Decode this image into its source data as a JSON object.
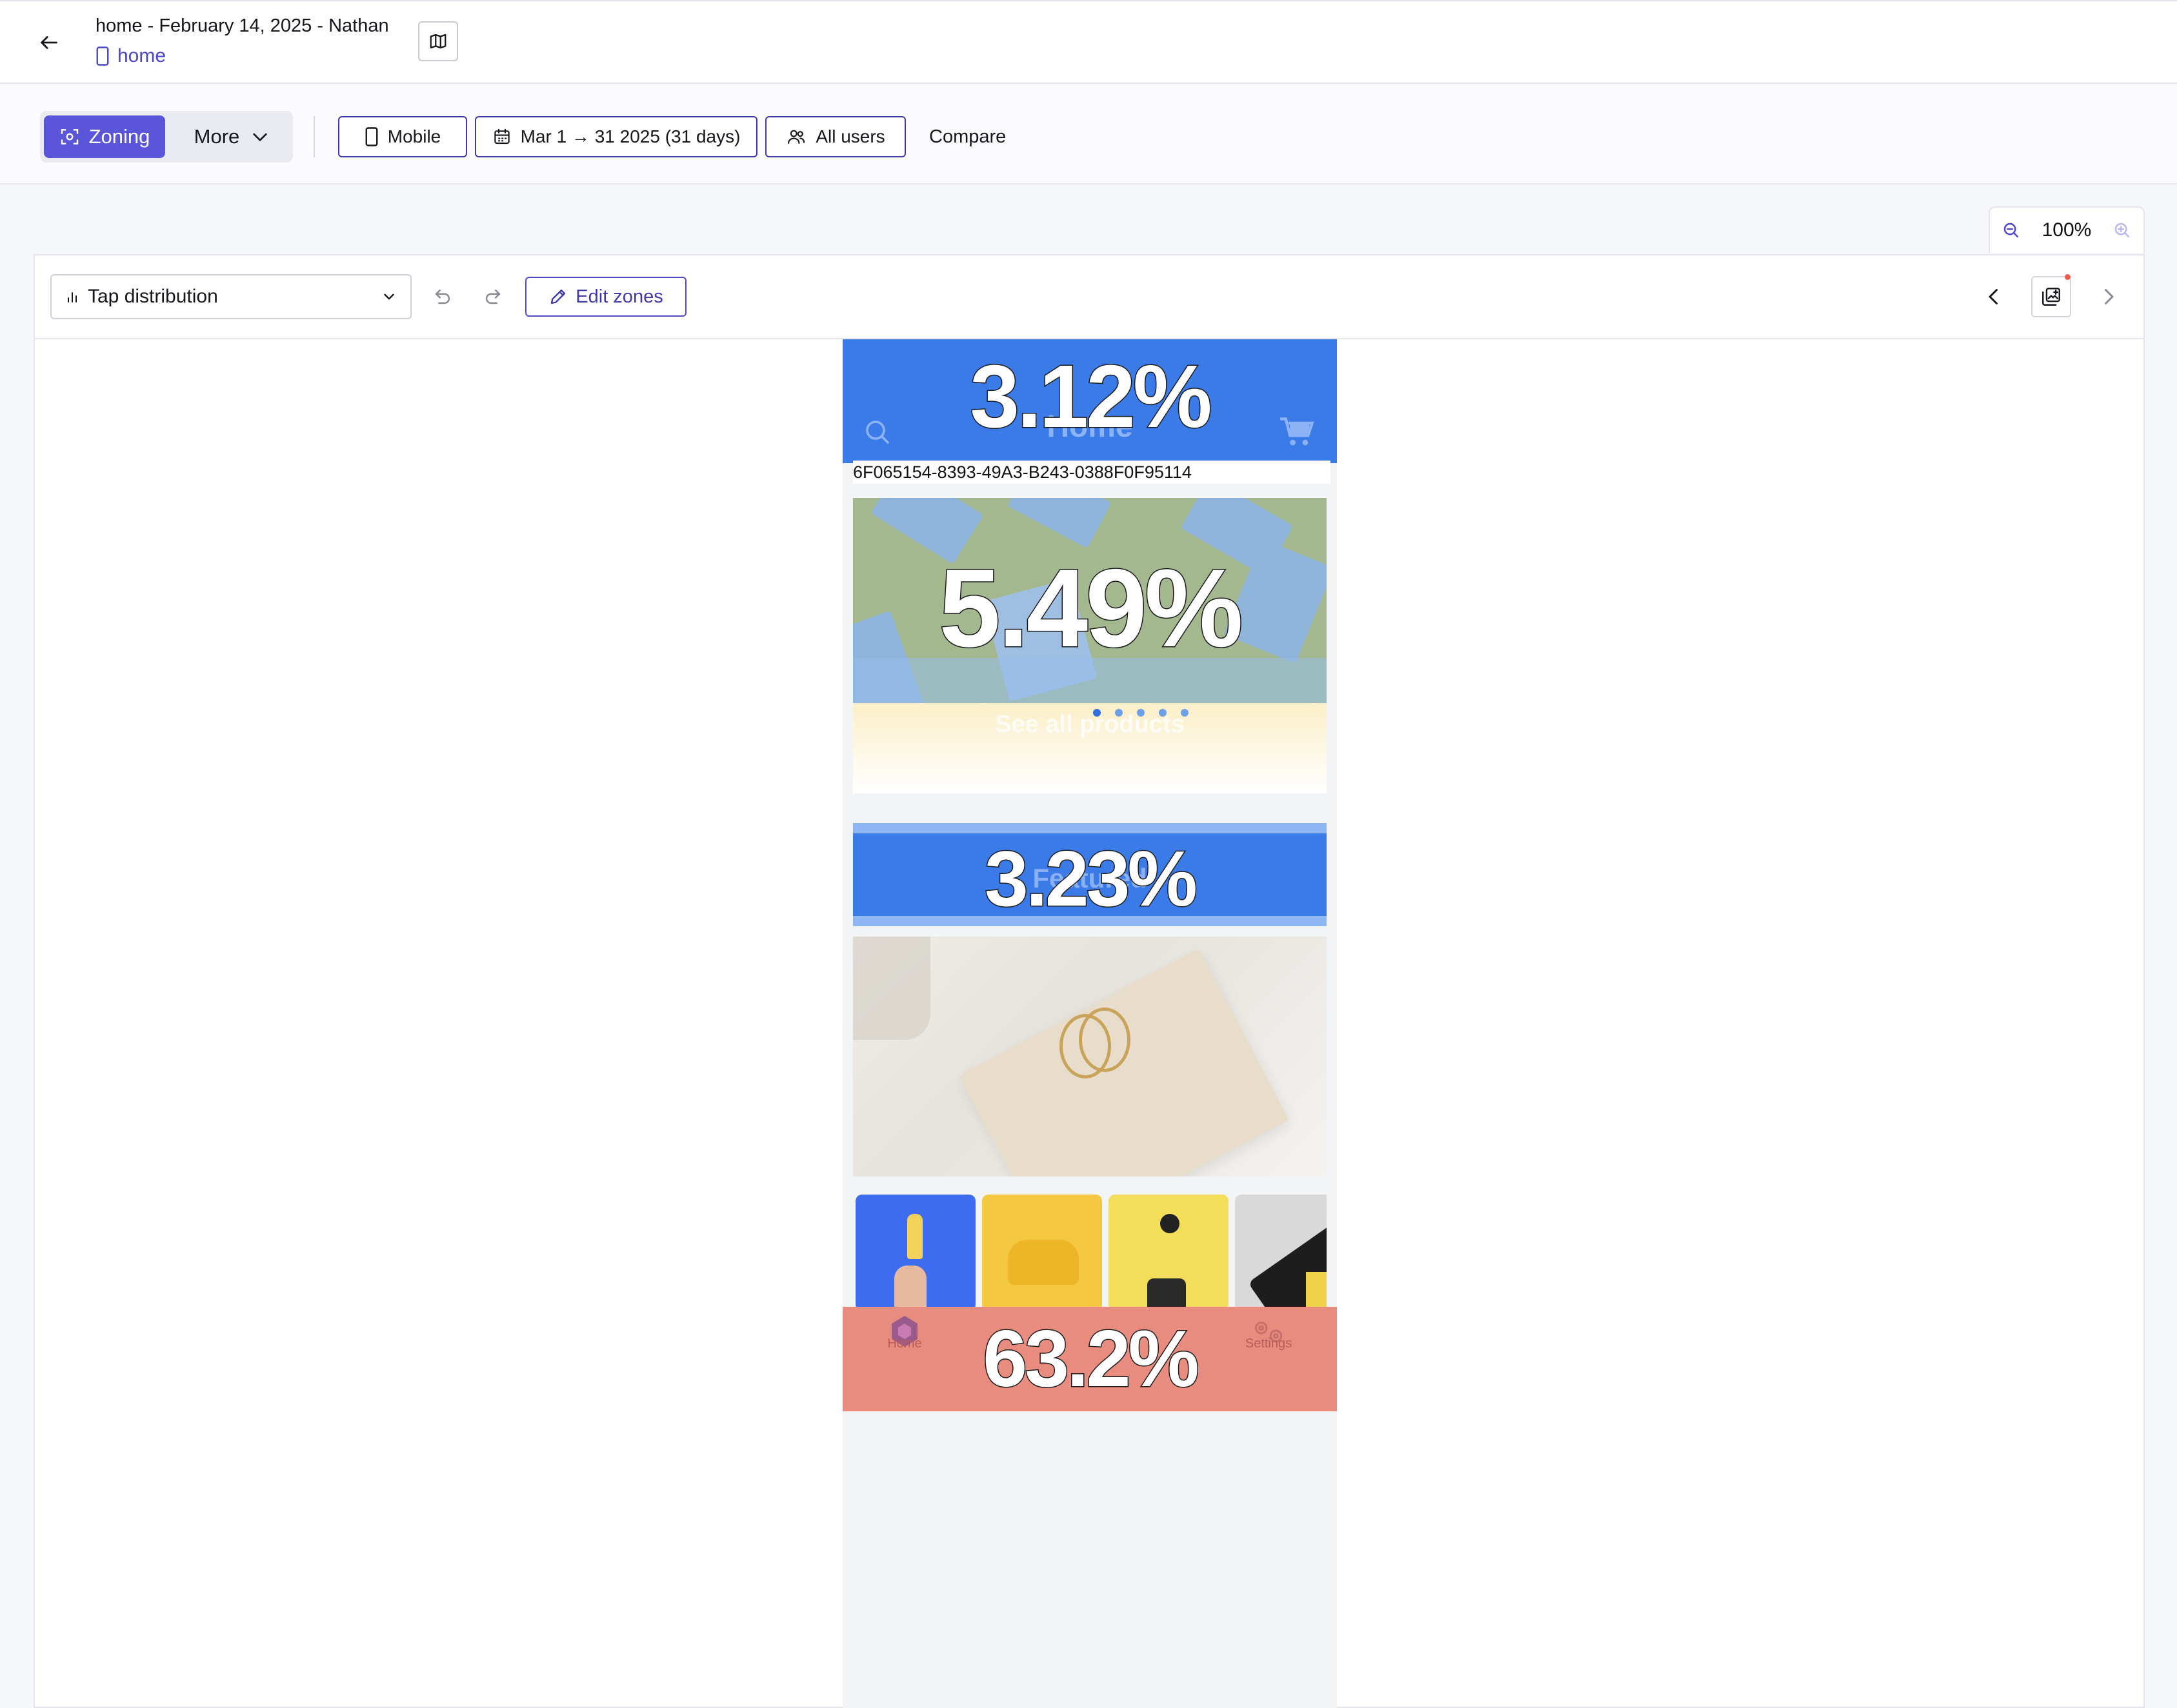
{
  "header": {
    "page_title": "home - February 14, 2025 - Nathan",
    "breadcrumb_label": "home"
  },
  "toolbar": {
    "zoning_label": "Zoning",
    "more_label": "More",
    "device_label": "Mobile",
    "date_range_label": "Mar 1 → 31 2025 (31 days)",
    "segment_label": "All users",
    "compare_label": "Compare"
  },
  "zoom": {
    "value_label": "100%"
  },
  "panel": {
    "metric_select_value": "Tap distribution",
    "edit_zones_label": "Edit zones"
  },
  "phone": {
    "header_title": "Home",
    "session_id": "6F065154-8393-49A3-B243-0388F0F95114",
    "see_all_label": "See all products",
    "featured_label": "Featured",
    "tabbar": {
      "home_label": "Home",
      "settings_label": "Settings"
    },
    "carousel_dots": 5,
    "carousel_active_dot": 0
  },
  "zones": {
    "header_value": "3.12%",
    "hero_value": "5.49%",
    "featured_value": "3.23%",
    "tabbar_value": "63.2%"
  },
  "colors": {
    "accent": "#5b55d9",
    "zone_cold": "#3b7be8",
    "zone_hot": "#e88c80",
    "chip_border": "#3f3aa8"
  },
  "icons": [
    "back-arrow-icon",
    "phone-icon",
    "map-icon",
    "zoning-icon",
    "chevron-down-icon",
    "calendar-icon",
    "users-icon",
    "zoom-out-icon",
    "zoom-in-icon",
    "bar-chart-icon",
    "undo-icon",
    "redo-icon",
    "pencil-icon",
    "chevron-left-icon",
    "chevron-right-icon",
    "snapshot-icon",
    "search-icon",
    "cart-icon",
    "home-hex-icon",
    "settings-gears-icon"
  ]
}
